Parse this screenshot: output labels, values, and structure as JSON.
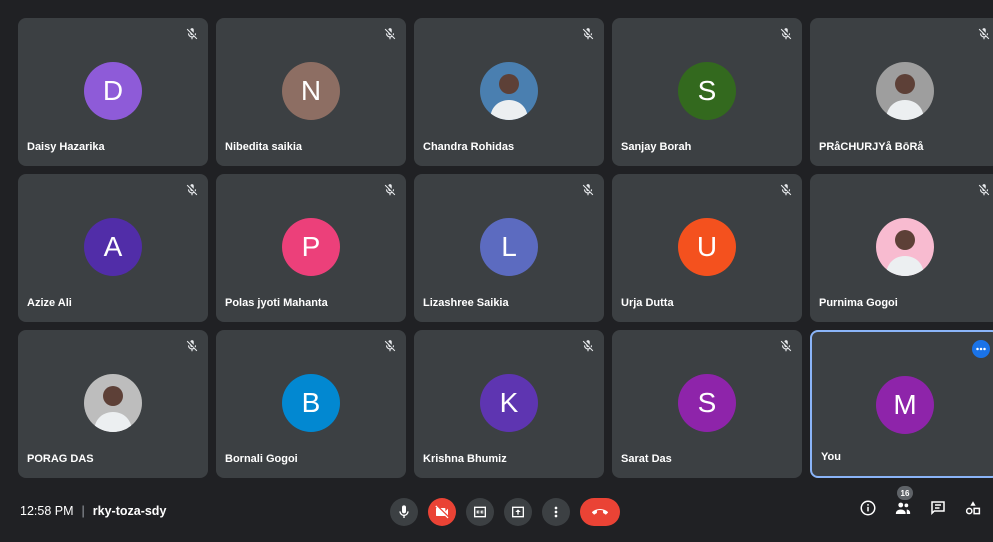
{
  "participants": [
    {
      "name": "Daisy Hazarika",
      "initial": "D",
      "color": "#8e5bd8",
      "avatar": "letter",
      "muted": true
    },
    {
      "name": "Nibedita saikia",
      "initial": "N",
      "color": "#8d6e63",
      "avatar": "letter",
      "muted": true
    },
    {
      "name": "Chandra Rohidas",
      "initial": "",
      "color": "#4a7fb0",
      "avatar": "photo",
      "muted": true
    },
    {
      "name": "Sanjay Borah",
      "initial": "S",
      "color": "#33691e",
      "avatar": "letter",
      "muted": true
    },
    {
      "name": "PRåCHURJYå BōRå",
      "initial": "",
      "color": "#9e9e9e",
      "avatar": "photo",
      "muted": true
    },
    {
      "name": "Azize Ali",
      "initial": "A",
      "color": "#512da8",
      "avatar": "letter",
      "muted": true
    },
    {
      "name": "Polas jyoti Mahanta",
      "initial": "P",
      "color": "#ec407a",
      "avatar": "letter",
      "muted": true
    },
    {
      "name": "Lizashree Saikia",
      "initial": "L",
      "color": "#5c6bc0",
      "avatar": "letter",
      "muted": true
    },
    {
      "name": "Urja Dutta",
      "initial": "U",
      "color": "#f4511e",
      "avatar": "letter",
      "muted": true
    },
    {
      "name": "Purnima Gogoi",
      "initial": "",
      "color": "#f8bbd0",
      "avatar": "photo",
      "muted": true
    },
    {
      "name": "PORAG DAS",
      "initial": "",
      "color": "#bdbdbd",
      "avatar": "photo",
      "muted": true
    },
    {
      "name": "Bornali Gogoi",
      "initial": "B",
      "color": "#0288d1",
      "avatar": "letter",
      "muted": true
    },
    {
      "name": "Krishna Bhumiz",
      "initial": "K",
      "color": "#5e35b1",
      "avatar": "letter",
      "muted": true
    },
    {
      "name": "Sarat Das",
      "initial": "S",
      "color": "#8e24aa",
      "avatar": "letter",
      "muted": true
    },
    {
      "name": "You",
      "initial": "M",
      "color": "#8e24aa",
      "avatar": "letter",
      "muted": false,
      "active": true
    }
  ],
  "meeting": {
    "time": "12:58 PM",
    "separator": "|",
    "code": "rky-toza-sdy"
  },
  "controls": {
    "icons": [
      "mic-icon",
      "camera-off-icon",
      "captions-icon",
      "present-icon",
      "more-vert-icon",
      "end-call-icon"
    ],
    "end_call_color": "#ea4335"
  },
  "right_controls": {
    "people_count": "16",
    "icons": [
      "info-icon",
      "people-icon",
      "chat-icon",
      "activities-icon"
    ]
  }
}
